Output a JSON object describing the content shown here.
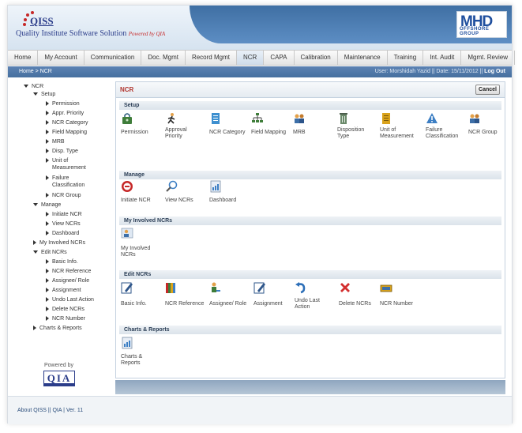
{
  "header": {
    "logo_text": "QISS",
    "tagline": "Quality Institute Software Solution",
    "powered_by_qia": "Powered by QIA",
    "client_logo_text": "MHD",
    "client_logo_sub": "OFFSHORE GROUP",
    "colors": {
      "band": "#4a78ad",
      "brand_red": "#b0342d"
    }
  },
  "nav": {
    "items": [
      {
        "label": "Home"
      },
      {
        "label": "My Account"
      },
      {
        "label": "Communication"
      },
      {
        "label": "Doc. Mgmt"
      },
      {
        "label": "Record Mgmt"
      },
      {
        "label": "NCR"
      },
      {
        "label": "CAPA"
      },
      {
        "label": "Calibration"
      },
      {
        "label": "Maintenance"
      },
      {
        "label": "Training"
      },
      {
        "label": "Int. Audit"
      },
      {
        "label": "Mgmt. Review"
      }
    ],
    "active_index": 5
  },
  "breadcrumb": "Home > NCR",
  "userinfo": {
    "text": "User: Morshidah Yazid  ||  Date: 15/11/2012  ||",
    "logout": "Log Out"
  },
  "sidebar": {
    "ncr": "NCR",
    "setup": "Setup",
    "setup_items": [
      "Permission",
      "Appr. Priority",
      "NCR Category",
      "Field Mapping",
      "MRB",
      "Disp. Type",
      "Unit of Measurement",
      "Failure Classification",
      "NCR Group"
    ],
    "manage": "Manage",
    "manage_items": [
      "Initiate NCR",
      "View NCRs",
      "Dashboard"
    ],
    "my_involved": "My Involved NCRs",
    "edit": "Edit NCRs",
    "edit_items": [
      "Basic Info.",
      "NCR Reference",
      "Assignee/ Role",
      "Assignment",
      "Undo Last Action",
      "Delete NCRs",
      "NCR Number"
    ],
    "charts": "Charts & Reports",
    "powered_by": "Powered by",
    "qia_logo": "QIA"
  },
  "content": {
    "title": "NCR",
    "cancel": "Cancel",
    "sections": {
      "setup": {
        "title": "Setup",
        "tiles": [
          {
            "label": "Permission",
            "icon": "permission-icon"
          },
          {
            "label": "Approval Priority",
            "icon": "priority-runner-icon"
          },
          {
            "label": "NCR Category",
            "icon": "category-doc-icon"
          },
          {
            "label": "Field Mapping",
            "icon": "field-mapping-icon"
          },
          {
            "label": "MRB",
            "icon": "mrb-group-icon"
          },
          {
            "label": "Disposition Type",
            "icon": "disposition-bin-icon"
          },
          {
            "label": "Unit of Measurement",
            "icon": "measurement-book-icon"
          },
          {
            "label": "Failure Classification",
            "icon": "warning-triangle-icon"
          },
          {
            "label": "NCR Group",
            "icon": "ncr-group-icon"
          }
        ]
      },
      "manage": {
        "title": "Manage",
        "tiles": [
          {
            "label": "Initiate NCR",
            "icon": "initiate-ncr-icon"
          },
          {
            "label": "View NCRs",
            "icon": "magnifier-icon"
          },
          {
            "label": "Dashboard",
            "icon": "dashboard-chart-icon"
          }
        ]
      },
      "involved": {
        "title": "My Involved NCRs",
        "tiles": [
          {
            "label": "My Involved NCRs",
            "icon": "involved-user-icon"
          }
        ]
      },
      "edit": {
        "title": "Edit NCRs",
        "tiles": [
          {
            "label": "Basic Info.",
            "icon": "edit-pencil-icon"
          },
          {
            "label": "NCR Reference",
            "icon": "reference-books-icon"
          },
          {
            "label": "Assignee/ Role",
            "icon": "assignee-user-icon"
          },
          {
            "label": "Assignment",
            "icon": "assignment-pencil-icon"
          },
          {
            "label": "Undo Last Action",
            "icon": "undo-icon"
          },
          {
            "label": "Delete NCRs",
            "icon": "delete-x-icon"
          },
          {
            "label": "NCR Number",
            "icon": "ncr-number-icon"
          }
        ]
      },
      "charts": {
        "title": "Charts & Reports",
        "tiles": [
          {
            "label": "Charts & Reports",
            "icon": "charts-reports-icon"
          }
        ]
      }
    }
  },
  "footer": {
    "text": "About QISS || QIA | Ver. 11"
  }
}
